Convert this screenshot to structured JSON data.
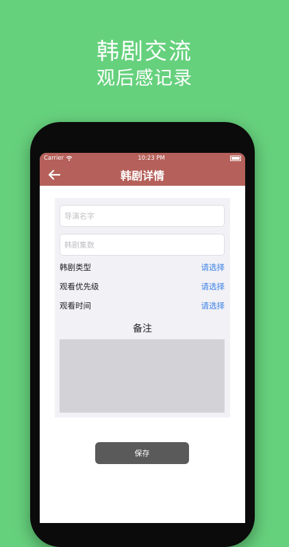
{
  "promo": {
    "title": "韩剧交流",
    "subtitle": "观后感记录"
  },
  "status_bar": {
    "carrier": "Carrier",
    "time": "10:23 PM"
  },
  "nav": {
    "title": "韩剧详情",
    "back_icon": "arrow-left-icon"
  },
  "form": {
    "director": {
      "placeholder": "导演名字",
      "value": ""
    },
    "episodes": {
      "placeholder": "韩剧集数",
      "value": ""
    },
    "rows": [
      {
        "label": "韩剧类型",
        "action": "请选择"
      },
      {
        "label": "观看优先级",
        "action": "请选择"
      },
      {
        "label": "观看时间",
        "action": "请选择"
      }
    ],
    "notes_label": "备注",
    "notes_value": ""
  },
  "save_label": "保存",
  "colors": {
    "background": "#66d17d",
    "nav_bar": "#b5605a",
    "link": "#3b82e6",
    "save_button": "#5a5a5a"
  }
}
